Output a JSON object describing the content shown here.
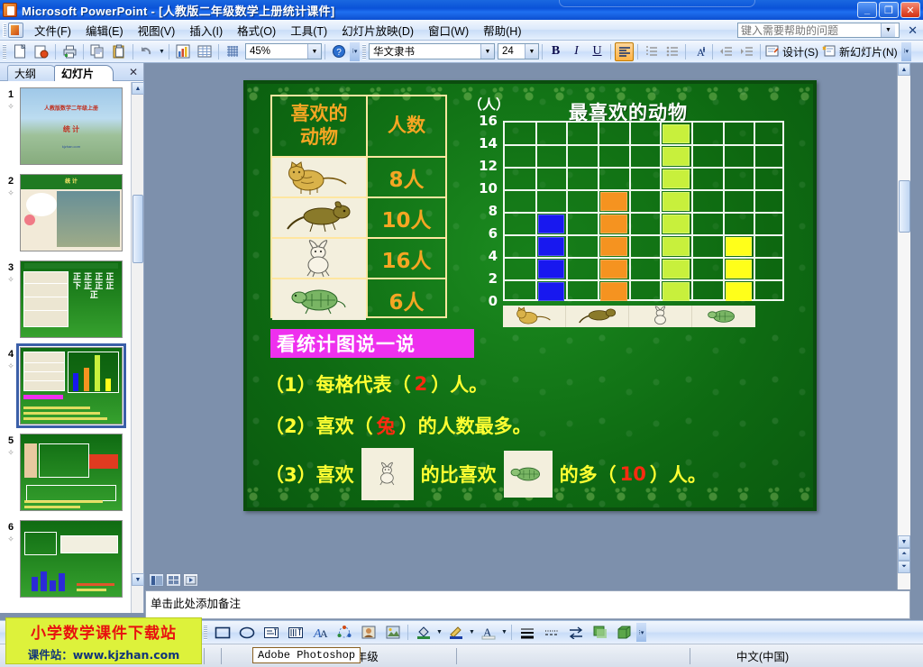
{
  "window": {
    "title": "Microsoft PowerPoint - [人教版二年级数学上册统计课件]",
    "app_icon": "powerpoint-icon",
    "minimize": "_",
    "restore": "❐",
    "close": "✕"
  },
  "menu": {
    "items": [
      {
        "label": "文件(F)"
      },
      {
        "label": "编辑(E)"
      },
      {
        "label": "视图(V)"
      },
      {
        "label": "插入(I)"
      },
      {
        "label": "格式(O)"
      },
      {
        "label": "工具(T)"
      },
      {
        "label": "幻灯片放映(D)"
      },
      {
        "label": "窗口(W)"
      },
      {
        "label": "帮助(H)"
      }
    ],
    "help_placeholder": "键入需要帮助的问题",
    "help_value": "",
    "close_label": "✕"
  },
  "toolbar": {
    "buttons": [
      {
        "name": "new-icon",
        "glyph": "🗋"
      },
      {
        "name": "open-icon",
        "glyph": "📂"
      },
      {
        "name": "print-icon",
        "glyph": "🖨"
      },
      {
        "name": "copy-icon",
        "glyph": "⧉"
      },
      {
        "name": "paste-icon",
        "glyph": "📋"
      },
      {
        "name": "undo-icon",
        "glyph": "↶"
      },
      {
        "name": "chart-icon",
        "glyph": "📊"
      },
      {
        "name": "table-icon",
        "glyph": "▦"
      },
      {
        "name": "grid-icon",
        "glyph": "▤"
      },
      {
        "name": "help-icon",
        "glyph": "?"
      }
    ],
    "zoom_value": "45%",
    "font_name": "华文隶书",
    "font_size": "24",
    "bold_label": "B",
    "italic_label": "I",
    "underline_label": "U",
    "align_left_label": "≡",
    "numbered_list_label": "⒈",
    "bullet_list_label": "•",
    "font_grow_label": "A",
    "decrease_indent_label": "⇤",
    "increase_indent_label": "⇥",
    "design_label": "设计(S)",
    "new_slide_label": "新幻灯片(N)",
    "overflow_label": "»"
  },
  "left_pane": {
    "tabs": [
      {
        "label": "大纲",
        "active": false
      },
      {
        "label": "幻灯片",
        "active": true
      }
    ],
    "close_label": "✕",
    "slides": [
      {
        "number": "1",
        "type": "title",
        "title_small": "人教版数学二年级上册",
        "title_main": "统  计",
        "footnote": "kjzhan.com"
      },
      {
        "number": "2",
        "type": "picture",
        "header": "统  计"
      },
      {
        "number": "3",
        "type": "tally"
      },
      {
        "number": "4",
        "type": "chart",
        "selected": true
      },
      {
        "number": "5",
        "type": "exercise"
      },
      {
        "number": "6",
        "type": "exercise2"
      }
    ]
  },
  "slide": {
    "table": {
      "header_col1_line1": "喜欢的",
      "header_col1_line2": "动物",
      "header_col2": "人数",
      "rows": [
        {
          "animal": "cat",
          "count": "8人"
        },
        {
          "animal": "dog",
          "count": "10人"
        },
        {
          "animal": "rabbit",
          "count": "16人"
        },
        {
          "animal": "turtle",
          "count": "6人"
        }
      ]
    },
    "pink_heading": "看统计图说一说",
    "questions": [
      {
        "prefix": "（1）每格代表（",
        "answer": "2",
        "suffix": "）人。"
      },
      {
        "prefix": "（2）喜欢（",
        "answer": "兔",
        "suffix": "）的人数最多。"
      },
      {
        "prefix3a": "（3）喜欢",
        "pic1": "rabbit",
        "mid": "的比喜欢",
        "pic2": "turtle",
        "after": "的多（",
        "answer": "10",
        "suffix": "）人。"
      }
    ]
  },
  "chart_data": {
    "type": "bar",
    "title": "最喜欢的动物",
    "unit_label": "（人）",
    "xlabel": "",
    "ylabel": "人",
    "categories": [
      "猫",
      "狗",
      "兔",
      "龟"
    ],
    "category_icons": [
      "cat",
      "dog",
      "rabbit",
      "turtle"
    ],
    "values": [
      8,
      10,
      16,
      6
    ],
    "bar_colors": [
      "#1818ef",
      "#f59320",
      "#c8f03c",
      "#ffff1a"
    ],
    "ylim": [
      0,
      16
    ],
    "ytick_labels": [
      "16",
      "14",
      "12",
      "10",
      "8",
      "6",
      "4",
      "2",
      "0"
    ],
    "yticks": [
      16,
      14,
      12,
      10,
      8,
      6,
      4,
      2,
      0
    ],
    "cell_value": 2,
    "grid_columns": 9,
    "grid_rows": 8,
    "grid": true,
    "legend": "none",
    "bar_column_index": [
      1,
      3,
      5,
      7
    ]
  },
  "notes": {
    "placeholder": "单击此处添加备注"
  },
  "draw_toolbar": {
    "buttons": [
      {
        "name": "rectangle-icon",
        "glyph": "▭"
      },
      {
        "name": "oval-icon",
        "glyph": "⬭"
      },
      {
        "name": "textbox-icon",
        "glyph": "▤"
      },
      {
        "name": "vertical-textbox-icon",
        "glyph": "▥"
      },
      {
        "name": "wordart-icon",
        "glyph": "A"
      },
      {
        "name": "diagram-icon",
        "glyph": "❂"
      },
      {
        "name": "clipart-icon",
        "glyph": "▣"
      },
      {
        "name": "picture-icon",
        "glyph": "▨"
      },
      {
        "name": "fill-color-icon",
        "glyph": "🪣"
      },
      {
        "name": "line-color-icon",
        "glyph": "✏"
      },
      {
        "name": "font-color-icon",
        "glyph": "A"
      },
      {
        "name": "line-style-icon",
        "glyph": "≡"
      },
      {
        "name": "dash-style-icon",
        "glyph": "┄"
      },
      {
        "name": "arrow-style-icon",
        "glyph": "⇄"
      },
      {
        "name": "shadow-icon",
        "glyph": "▥"
      },
      {
        "name": "3d-icon",
        "glyph": "◨"
      }
    ],
    "overflow_label": "»"
  },
  "status_bar": {
    "doc_title": "小学数学低年级",
    "taskbar_item": "Adobe Photoshop",
    "language": "中文(中国)"
  },
  "watermark": {
    "line1": "小学数学课件下载站",
    "line2": "课件站：www.kjzhan.com",
    "bg_color": "#ddf23b",
    "line1_color": "#e8110f",
    "line2_color": "#10347a"
  },
  "view_buttons": [
    {
      "name": "normal-view",
      "glyph": "▤",
      "on": true
    },
    {
      "name": "sorter-view",
      "glyph": "▩",
      "on": false
    },
    {
      "name": "slideshow-view",
      "glyph": "▷",
      "on": false
    }
  ]
}
